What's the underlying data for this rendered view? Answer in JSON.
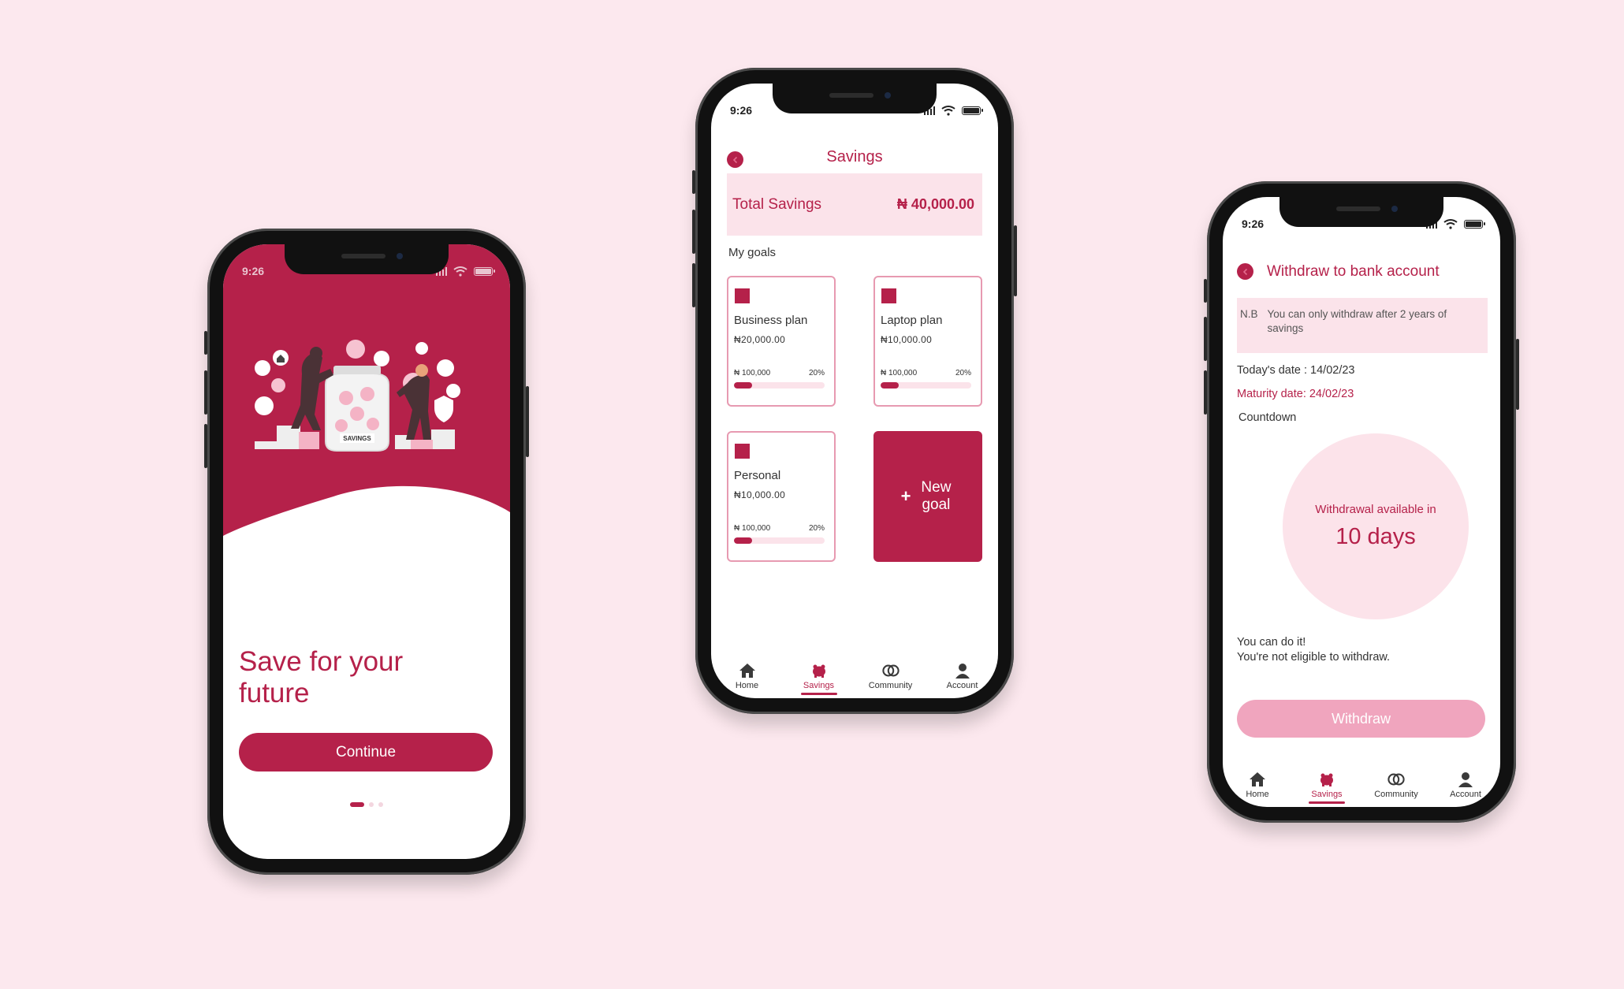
{
  "colors": {
    "brand": "#b5214a",
    "brand_light": "#fbe3ea",
    "background": "#fce8ee",
    "button_disabled": "#f0a5be"
  },
  "status": {
    "time": "9:26"
  },
  "onboarding": {
    "illustration_label": "SAVINGS",
    "title": "Save for your future",
    "continue_label": "Continue",
    "pager": {
      "total": 3,
      "active": 1
    }
  },
  "savings": {
    "title": "Savings",
    "total_label": "Total Savings",
    "total_value": "₦ 40,000.00",
    "my_goals_label": "My goals",
    "goals": [
      {
        "name": "Business plan",
        "amount": "₦20,000.00",
        "target": "₦ 100,000",
        "percent": "20%",
        "progress": 0.2
      },
      {
        "name": "Laptop plan",
        "amount": "₦10,000.00",
        "target": "₦ 100,000",
        "percent": "20%",
        "progress": 0.2
      },
      {
        "name": "Personal",
        "amount": "₦10,000.00",
        "target": "₦ 100,000",
        "percent": "20%",
        "progress": 0.2
      }
    ],
    "new_goal_plus": "+",
    "new_goal_label": "New goal"
  },
  "withdraw": {
    "title": "Withdraw to bank account",
    "nb_label": "N.B",
    "nb_text": "You can only withdraw after 2 years of savings",
    "today": "Today's date : 14/02/23",
    "maturity": "Maturity date: 24/02/23",
    "countdown_label": "Countdown",
    "available_label": "Withdrawal available in",
    "days": "10 days",
    "msg1": "You can do it!",
    "msg2": "You're not eligible to withdraw.",
    "withdraw_label": "Withdraw"
  },
  "tabs": [
    {
      "label": "Home",
      "icon": "home-icon"
    },
    {
      "label": "Savings",
      "icon": "piggy-bank-icon"
    },
    {
      "label": "Community",
      "icon": "community-rings-icon"
    },
    {
      "label": "Account",
      "icon": "person-icon"
    }
  ],
  "active_tab": "Savings"
}
